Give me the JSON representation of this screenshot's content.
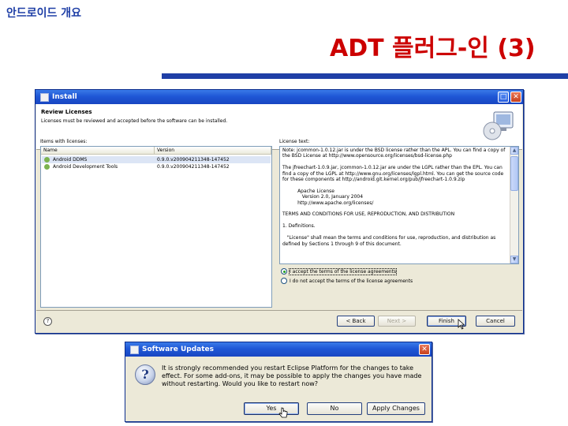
{
  "slide": {
    "subtitle": "안드로이드 개요",
    "title": "ADT 플러그-인 (3)"
  },
  "install_window": {
    "title": "Install",
    "header_title": "Review Licenses",
    "header_description": "Licenses must be reviewed and accepted before the software can be installed.",
    "items_label": "Items with licenses:",
    "columns": [
      "Name",
      "Version"
    ],
    "items": [
      {
        "name": "Android DDMS",
        "version": "0.9.0.v200904211348-147452"
      },
      {
        "name": "Android Development Tools",
        "version": "0.9.0.v200904211348-147452"
      }
    ],
    "license_label": "License text:",
    "license_text": "Note: jcommon-1.0.12.jar is under the BSD license rather than the APL. You can find a copy of the BSD License at http://www.opensource.org/licenses/bsd-license.php\n\nThe jfreechart-1.0.9.jar, jcommon-1.0.12.jar are under the LGPL rather than the EPL. You can find a copy of the LGPL at http://www.gnu.org/licenses/lgpl.html. You can get the source code for these components at http://android.git.kernel.org/pub/jfreechart-1.0.9.zip\n\n          Apache License\n             Version 2.0, January 2004\n          http://www.apache.org/licenses/\n\nTERMS AND CONDITIONS FOR USE, REPRODUCTION, AND DISTRIBUTION\n\n1. Definitions.\n\n   \"License\" shall mean the terms and conditions for use, reproduction, and distribution as defined by Sections 1 through 9 of this document.",
    "accept_label": "I accept the terms of the license agreements",
    "decline_label": "I do not accept the terms of the license agreements",
    "buttons": {
      "back": "< Back",
      "next": "Next >",
      "finish": "Finish",
      "cancel": "Cancel"
    },
    "help_glyph": "?",
    "icons": [
      "install-wizard-icon",
      "help-icon",
      "plugin-icon"
    ]
  },
  "updates_dialog": {
    "title": "Software Updates",
    "message": "It is strongly recommended you restart Eclipse Platform for the changes to take effect. For some add-ons, it may be possible to apply the changes you have made without restarting. Would you like to restart now?",
    "question_glyph": "?",
    "buttons": {
      "yes": "Yes",
      "no": "No",
      "apply": "Apply Changes"
    }
  },
  "colors": {
    "title_red": "#cc0000",
    "accent_blue": "#1f3fa6",
    "xp_titlebar": "#1f57d6"
  }
}
